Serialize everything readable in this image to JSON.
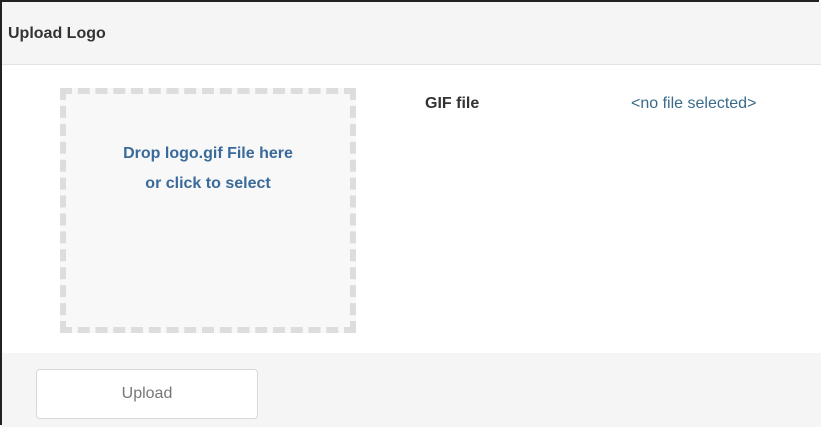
{
  "header": {
    "title": "Upload Logo"
  },
  "dropzone": {
    "line1": "Drop logo.gif File here",
    "line2": "or click to select"
  },
  "file": {
    "label": "GIF file",
    "value": "<no file selected>"
  },
  "footer": {
    "upload_label": "Upload",
    "upload_enabled": false
  },
  "colors": {
    "header_bg": "#f5f5f5",
    "dropzone_border": "#dddddd",
    "dropzone_text": "#3a6a9a",
    "link_text": "#3a6a8a"
  }
}
